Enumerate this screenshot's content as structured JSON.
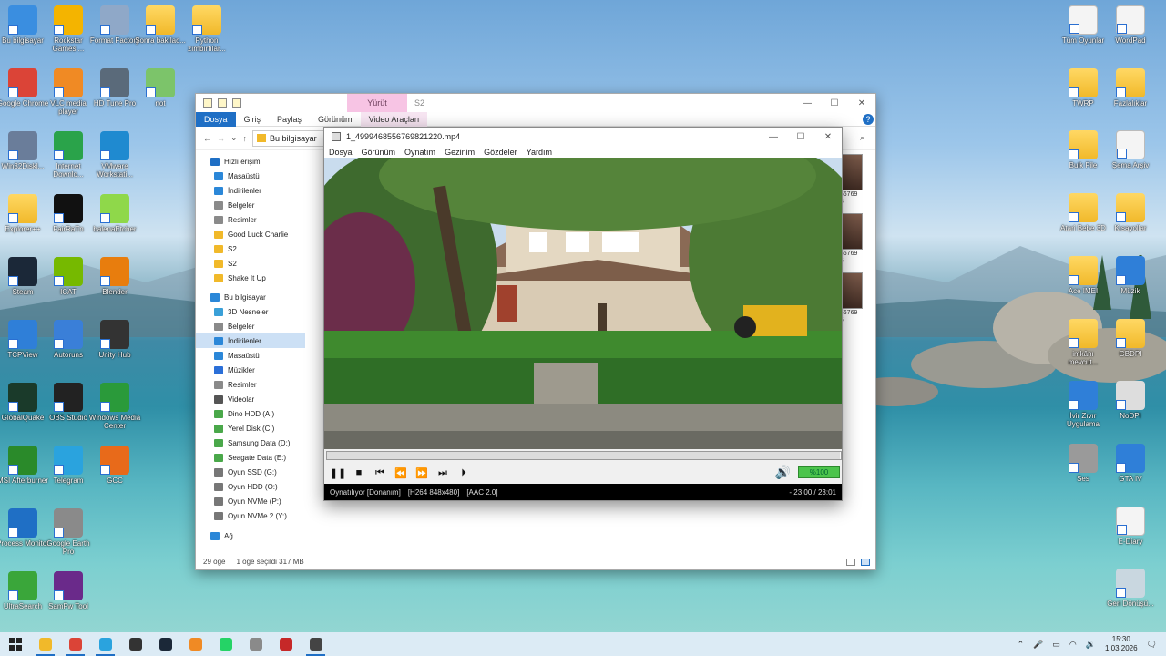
{
  "desktop": {
    "left_icons": [
      {
        "label": "Bu bilgisayar",
        "icon": "computer-icon"
      },
      {
        "label": "Rockstar Games ...",
        "icon": "rockstar-icon"
      },
      {
        "label": "Format Factory",
        "icon": "format-factory-icon"
      },
      {
        "label": "Sonra bakılac...",
        "icon": "folder-icon"
      },
      {
        "label": "Python zımbırtılar...",
        "icon": "folder-icon"
      },
      {
        "label": "Google Chrome",
        "icon": "chrome-icon"
      },
      {
        "label": "VLC media player",
        "icon": "vlc-icon"
      },
      {
        "label": "HD Tune Pro",
        "icon": "hdtune-icon"
      },
      {
        "label": "not",
        "icon": "notepad-icon"
      },
      {
        "label": "Win32Diskl...",
        "icon": "win32disk-icon"
      },
      {
        "label": "Internet Downlo...",
        "icon": "idm-icon"
      },
      {
        "label": "VMware Workstati...",
        "icon": "vmware-icon"
      },
      {
        "label": "Explorer++",
        "icon": "folder-icon"
      },
      {
        "label": "FairRaTn",
        "icon": "fairplay-icon"
      },
      {
        "label": "balenaEtcher",
        "icon": "etcher-icon"
      },
      {
        "label": "Steam",
        "icon": "steam-icon"
      },
      {
        "label": "ICAT",
        "icon": "nvidia-icon"
      },
      {
        "label": "Blender",
        "icon": "blender-icon"
      },
      {
        "label": "TCPView",
        "icon": "tcpview-icon"
      },
      {
        "label": "Autoruns",
        "icon": "autoruns-icon"
      },
      {
        "label": "Unity Hub",
        "icon": "unity-icon"
      },
      {
        "label": "GlobalQuake",
        "icon": "globalquake-icon"
      },
      {
        "label": "OBS Studio",
        "icon": "obs-icon"
      },
      {
        "label": "Windows Media Center",
        "icon": "media-center-icon"
      },
      {
        "label": "MSI Afterburner",
        "icon": "afterburner-icon"
      },
      {
        "label": "Telegram",
        "icon": "telegram-icon"
      },
      {
        "label": "GCC",
        "icon": "gcc-icon"
      },
      {
        "label": "Process Monitor",
        "icon": "procmon-icon"
      },
      {
        "label": "Google Earth Pro",
        "icon": "earth-icon"
      },
      {
        "label": "UltraSearch",
        "icon": "ultrasearch-icon"
      },
      {
        "label": "SamFw Tool",
        "icon": "samfw-icon"
      }
    ],
    "right_icons": [
      {
        "label": "Tüm Oyunlar",
        "icon": "doc-icon"
      },
      {
        "label": "WordPad",
        "icon": "wordpad-icon"
      },
      {
        "label": "TWRP",
        "icon": "folder-icon"
      },
      {
        "label": "Fazlalıklar",
        "icon": "folder-icon"
      },
      {
        "label": "Bulk File",
        "icon": "folder-icon"
      },
      {
        "label": "Şema Arşiv",
        "icon": "doc-icon"
      },
      {
        "label": "Atari Bebe 3D",
        "icon": "folder-icon"
      },
      {
        "label": "Kısayollar",
        "icon": "folder-icon"
      },
      {
        "label": "Ace IMEI",
        "icon": "folder-icon"
      },
      {
        "label": "Müzik",
        "icon": "music-icon"
      },
      {
        "label": "imkânı mevcut...",
        "icon": "folder-icon"
      },
      {
        "label": "GBDPI",
        "icon": "folder-icon"
      },
      {
        "label": "İvir Zıvır Uygulama",
        "icon": "app-icon"
      },
      {
        "label": "NoDPI",
        "icon": "gear-icon"
      },
      {
        "label": "Ses",
        "icon": "speaker-icon"
      },
      {
        "label": "GTA IV",
        "icon": "gta-icon"
      },
      {
        "label": "E-Diary",
        "icon": "doc-icon"
      },
      {
        "label": "Geri Dönüşü...",
        "icon": "recycle-bin-icon"
      }
    ]
  },
  "explorer": {
    "title": "S2",
    "context_tab": "Yürüt",
    "ribbon_tabs": [
      "Dosya",
      "Giriş",
      "Paylaş",
      "Görünüm",
      "Video Araçları"
    ],
    "address": "Bu bilgisayar",
    "nav": [
      {
        "label": "Hızlı erişim",
        "color": "#1f6fc5"
      },
      {
        "label": "Masaüstü",
        "color": "#2b87d8"
      },
      {
        "label": "İndirilenler",
        "color": "#2b87d8"
      },
      {
        "label": "Belgeler",
        "color": "#8a8a8a"
      },
      {
        "label": "Resimler",
        "color": "#8a8a8a"
      },
      {
        "label": "Good Luck Charlie",
        "color": "#f1b92a"
      },
      {
        "label": "S2",
        "color": "#f1b92a"
      },
      {
        "label": "S2",
        "color": "#f1b92a"
      },
      {
        "label": "Shake It Up",
        "color": "#f1b92a"
      },
      {
        "label": "Bu bilgisayar",
        "color": "#2b87d8"
      },
      {
        "label": "3D Nesneler",
        "color": "#3aa0d8"
      },
      {
        "label": "Belgeler",
        "color": "#8a8a8a"
      },
      {
        "label": "İndirilenler",
        "color": "#2b87d8"
      },
      {
        "label": "Masaüstü",
        "color": "#2b87d8"
      },
      {
        "label": "Müzikler",
        "color": "#2b6fd8"
      },
      {
        "label": "Resimler",
        "color": "#8a8a8a"
      },
      {
        "label": "Videolar",
        "color": "#555555"
      },
      {
        "label": "Dino HDD (A:)",
        "color": "#4aa84a"
      },
      {
        "label": "Yerel Disk (C:)",
        "color": "#4aa84a"
      },
      {
        "label": "Samsung Data (D:)",
        "color": "#4aa84a"
      },
      {
        "label": "Seagate Data (E:)",
        "color": "#4aa84a"
      },
      {
        "label": "Oyun SSD (G:)",
        "color": "#777777"
      },
      {
        "label": "Oyun HDD (O:)",
        "color": "#777777"
      },
      {
        "label": "Oyun NVMe (P:)",
        "color": "#777777"
      },
      {
        "label": "Oyun NVMe 2 (Y:)",
        "color": "#777777"
      },
      {
        "label": "Ağ",
        "color": "#2b87d8"
      }
    ],
    "thumb_labels": [
      "556769\n28",
      "556769\n36",
      "556769\n36"
    ],
    "status_count": "29 öğe",
    "status_selected": "1 öğe seçildi  317 MB"
  },
  "player": {
    "title": "1_4999468556769821220.mp4",
    "menu": [
      "Dosya",
      "Görünüm",
      "Oynatım",
      "Gezinim",
      "Gözdeler",
      "Yardım"
    ],
    "state": "Oynatılıyor [Donanım]",
    "video_info": "[H264 848x480]",
    "audio_info": "[AAC 2.0]",
    "time": "- 23:00 / 23:01",
    "volume": "%100",
    "progress": 0.998
  },
  "taskbar": {
    "apps": [
      {
        "icon": "file-explorer-icon",
        "color": "#f1b92a"
      },
      {
        "icon": "chrome-icon",
        "color": "#db4437"
      },
      {
        "icon": "telegram-icon",
        "color": "#2aa3de"
      },
      {
        "icon": "terminal-icon",
        "color": "#333333"
      },
      {
        "icon": "steam-icon",
        "color": "#1b2838"
      },
      {
        "icon": "media-player-icon",
        "color": "#f08a24"
      },
      {
        "icon": "whatsapp-icon",
        "color": "#25d366"
      },
      {
        "icon": "device-icon",
        "color": "#8a8a8a"
      },
      {
        "icon": "recorder-icon",
        "color": "#c62828"
      },
      {
        "icon": "mpc-icon",
        "color": "#444444"
      }
    ],
    "time": "15:30",
    "date": "1.03.2026"
  }
}
